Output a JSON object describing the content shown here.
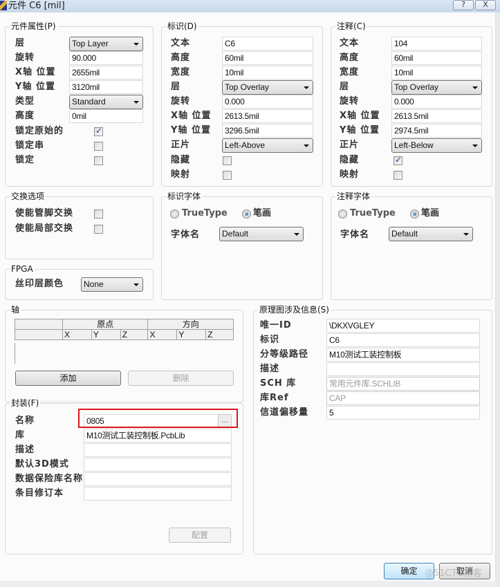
{
  "window": {
    "title": "元件 C6 [mil]",
    "help_label": "?",
    "close_label": "X"
  },
  "component_properties": {
    "title": "元件属性(P)",
    "layer": {
      "label": "层",
      "value": "Top Layer"
    },
    "rotation": {
      "label": "旋转",
      "value": "90.000"
    },
    "x_location": {
      "label": "X轴 位置",
      "value": "2655mil"
    },
    "y_location": {
      "label": "Y轴 位置",
      "value": "3120mil"
    },
    "type": {
      "label": "类型",
      "value": "Standard"
    },
    "height": {
      "label": "高度",
      "value": "0mil"
    },
    "lock_primitives": {
      "label": "锁定原始的",
      "checked": true
    },
    "lock_strings": {
      "label": "锁定串",
      "checked": false
    },
    "locked": {
      "label": "锁定",
      "checked": false
    }
  },
  "designator": {
    "title": "标识(D)",
    "text": {
      "label": "文本",
      "value": "C6"
    },
    "height": {
      "label": "高度",
      "value": "60mil"
    },
    "width": {
      "label": "宽度",
      "value": "10mil"
    },
    "layer": {
      "label": "层",
      "value": "Top Overlay"
    },
    "rotation": {
      "label": "旋转",
      "value": "0.000"
    },
    "x_location": {
      "label": "X轴 位置",
      "value": "2613.5mil"
    },
    "y_location": {
      "label": "Y轴 位置",
      "value": "3296.5mil"
    },
    "autoposition": {
      "label": "正片",
      "value": "Left-Above"
    },
    "hide": {
      "label": "隐藏",
      "checked": false
    },
    "mirror": {
      "label": "映射",
      "checked": false
    }
  },
  "comment": {
    "title": "注释(C)",
    "text": {
      "label": "文本",
      "value": "104"
    },
    "height": {
      "label": "高度",
      "value": "60mil"
    },
    "width": {
      "label": "宽度",
      "value": "10mil"
    },
    "layer": {
      "label": "层",
      "value": "Top Overlay"
    },
    "rotation": {
      "label": "旋转",
      "value": "0.000"
    },
    "x_location": {
      "label": "X轴 位置",
      "value": "2613.5mil"
    },
    "y_location": {
      "label": "Y轴 位置",
      "value": "2974.5mil"
    },
    "autoposition": {
      "label": "正片",
      "value": "Left-Below"
    },
    "hide": {
      "label": "隐藏",
      "checked": true
    },
    "mirror": {
      "label": "映射",
      "checked": false
    }
  },
  "swapping_options": {
    "title": "交换选项",
    "enable_pin_swaps": {
      "label": "使能管脚交换",
      "checked": false
    },
    "enable_part_swaps": {
      "label": "使能局部交换",
      "checked": false
    }
  },
  "designator_font": {
    "title": "标识字体",
    "truetype_label": "TrueType",
    "stroke_label": "笔画",
    "selected": "stroke",
    "font_name_label": "字体名",
    "font_name_value": "Default"
  },
  "comment_font": {
    "title": "注释字体",
    "truetype_label": "TrueType",
    "stroke_label": "笔画",
    "selected": "stroke",
    "font_name_label": "字体名",
    "font_name_value": "Default"
  },
  "fpga": {
    "title": "FPGA",
    "silkscreen_color_label": "丝印层颜色",
    "silkscreen_color_value": "None"
  },
  "axis": {
    "title": "轴",
    "header_groups": [
      "原点",
      "方向"
    ],
    "columns": [
      "X",
      "Y",
      "Z",
      "X",
      "Y",
      "Z"
    ],
    "rows": [],
    "add_label": "添加",
    "delete_label": "删除"
  },
  "schematic_info": {
    "title": "原理图涉及信息(S)",
    "unique_id": {
      "label": "唯一ID",
      "value": "\\DKXVGLEY"
    },
    "designator": {
      "label": "标识",
      "value": "C6"
    },
    "hierarchical_path": {
      "label": "分等级路径",
      "value": "M10测试工装控制板"
    },
    "description": {
      "label": "描述",
      "value": ""
    },
    "sch_library": {
      "label": "SCH 库",
      "value": "常用元件库.SCHLIB"
    },
    "library_ref": {
      "label": "库Ref",
      "value": "CAP"
    },
    "channel_offset": {
      "label": "信道偏移量",
      "value": "5"
    }
  },
  "footprint": {
    "title": "封装(F)",
    "name": {
      "label": "名称",
      "value": "0805",
      "browse_label": "..."
    },
    "library": {
      "label": "库",
      "value": "M10测试工装控制板.PcbLib"
    },
    "description": {
      "label": "描述",
      "value": ""
    },
    "default_3d_model": {
      "label": "默认3D模式",
      "value": ""
    },
    "vault_library_name": {
      "label": "数据保险库名称",
      "value": ""
    },
    "item_revision": {
      "label": "条目修订本",
      "value": ""
    },
    "configure_label": "配置"
  },
  "footer": {
    "ok_label": "确定",
    "cancel_label": "取消"
  },
  "watermark": "@51CTO博客",
  "colors": {
    "highlight_border": "#d9161c",
    "default_button_border": "#3c7fb1"
  }
}
